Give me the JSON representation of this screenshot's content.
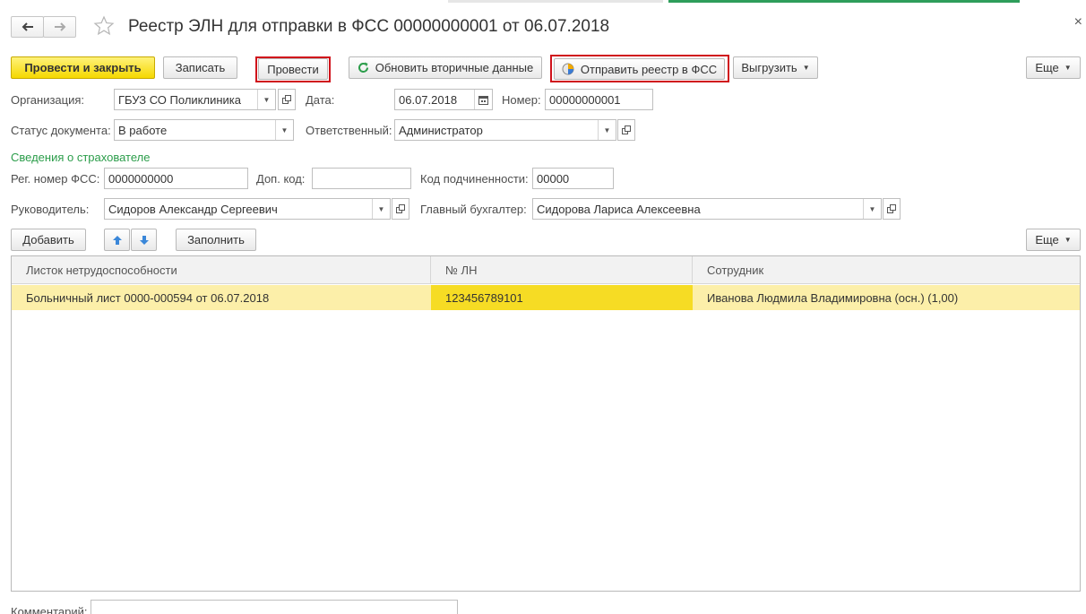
{
  "window": {
    "title": "Реестр ЭЛН для отправки в ФСС 00000000001 от 06.07.2018",
    "close_glyph": "×"
  },
  "nav": {
    "back_icon": "arrow-left-icon",
    "forward_icon": "arrow-right-icon",
    "favorite_icon": "star-icon"
  },
  "toolbar": {
    "post_close": "Провести и закрыть",
    "save": "Записать",
    "post": "Провести",
    "refresh": "Обновить вторичные данные",
    "send": "Отправить реестр в ФСС",
    "export": "Выгрузить",
    "more": "Еще"
  },
  "form": {
    "org_label": "Организация:",
    "org_value": "ГБУЗ СО Поликлиника",
    "date_label": "Дата:",
    "date_value": "06.07.2018",
    "number_label": "Номер:",
    "number_value": "00000000001",
    "status_label": "Статус документа:",
    "status_value": "В работе",
    "responsible_label": "Ответственный:",
    "responsible_value": "Администратор",
    "insurer_section": "Сведения о страхователе",
    "reg_label": "Рег. номер ФСС:",
    "reg_value": "0000000000",
    "addcode_label": "Доп. код:",
    "addcode_value": "",
    "subcode_label": "Код подчиненности:",
    "subcode_value": "00000",
    "head_label": "Руководитель:",
    "head_value": "Сидоров Александр Сергеевич",
    "accountant_label": "Главный бухгалтер:",
    "accountant_value": "Сидорова Лариса Алексеевна"
  },
  "table_toolbar": {
    "add": "Добавить",
    "fill": "Заполнить",
    "more": "Еще"
  },
  "table": {
    "columns": [
      "Листок нетрудоспособности",
      "№ ЛН",
      "Сотрудник"
    ],
    "rows": [
      [
        "Больничный лист 0000-000594 от 06.07.2018",
        "123456789101",
        "Иванова Людмила Владимировна (осн.) (1,00)"
      ]
    ]
  },
  "comment_label": "Комментарий:",
  "colors": {
    "primary": "#f5d800",
    "section": "#2b9d4a",
    "highlight": "#d0121b",
    "row_selected": "#fcefa9",
    "cell_active": "#f6dc24"
  }
}
